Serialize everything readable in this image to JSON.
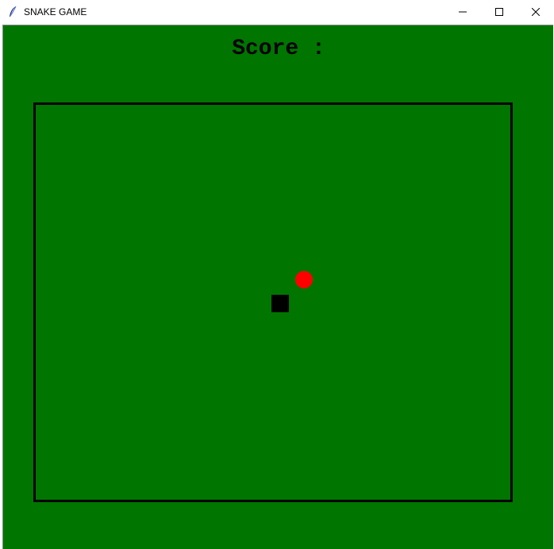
{
  "window": {
    "title": "SNAKE GAME",
    "app_icon": "feather-icon",
    "controls": [
      "minimize-icon",
      "maximize-icon",
      "close-icon"
    ]
  },
  "game": {
    "score_label": "Score :",
    "background_color": "#007500",
    "border_color": "#000000",
    "food": {
      "icon": "food-dot",
      "color": "#ff0000"
    },
    "snake": {
      "icon": "snake-segment",
      "color": "#000000",
      "length": 1
    }
  }
}
